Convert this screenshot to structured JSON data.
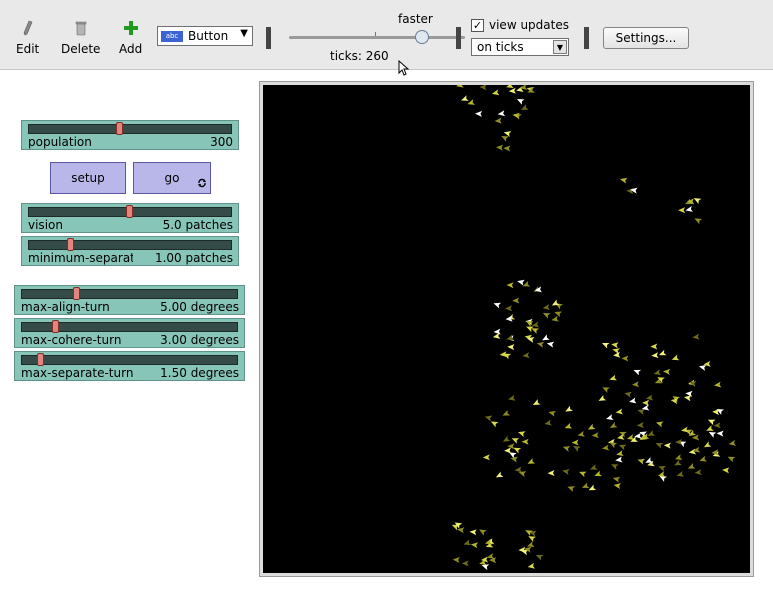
{
  "toolbar": {
    "edit_label": "Edit",
    "delete_label": "Delete",
    "add_label": "Add",
    "widget_type": "Button",
    "speed_label": "faster",
    "ticks_label": "ticks:",
    "ticks_value": "260",
    "view_updates_label": "view updates",
    "view_updates_checked": true,
    "update_mode": "on ticks",
    "settings_label": "Settings..."
  },
  "sliders": [
    {
      "label": "population",
      "value": "300",
      "fraction": 0.45
    },
    {
      "label": "vision",
      "value": "5.0 patches",
      "fraction": 0.5
    },
    {
      "label": "minimum-separat...",
      "value": "1.00 patches",
      "fraction": 0.2
    },
    {
      "label": "max-align-turn",
      "value": "5.00 degrees",
      "fraction": 0.25
    },
    {
      "label": "max-cohere-turn",
      "value": "3.00 degrees",
      "fraction": 0.15
    },
    {
      "label": "max-separate-turn",
      "value": "1.50 degrees",
      "fraction": 0.075
    }
  ],
  "buttons": {
    "setup_label": "setup",
    "go_label": "go",
    "go_forever_icon": "forever-arrows-icon"
  },
  "world": {
    "background": "#000000",
    "agent_colors": [
      "#ffffff",
      "#f2f27a",
      "#d8d84a",
      "#b7b72e",
      "#8f8f22",
      "#6b6b18"
    ]
  }
}
